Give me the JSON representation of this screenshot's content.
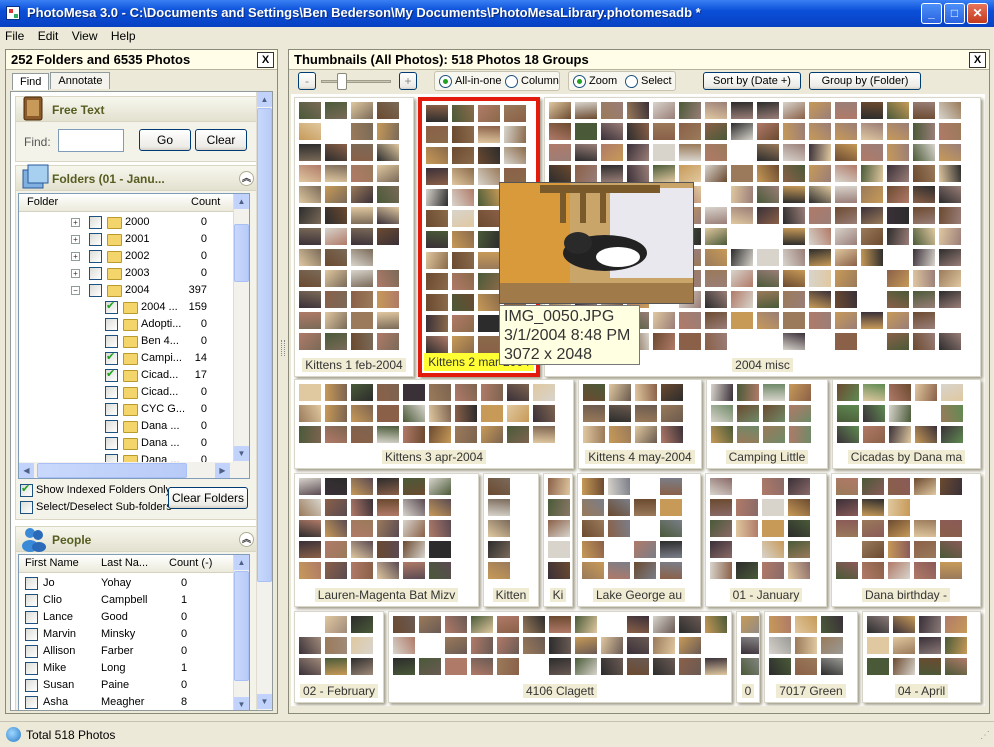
{
  "window": {
    "title": "PhotoMesa 3.0 - C:\\Documents and Settings\\Ben Bederson\\My Documents\\PhotoMesaLibrary.photomesadb *",
    "icons": [
      "app-icon",
      "minimize-icon",
      "maximize-icon",
      "close-icon"
    ]
  },
  "menu": [
    "File",
    "Edit",
    "View",
    "Help"
  ],
  "left_panel": {
    "title": "252 Folders and 6535 Photos",
    "close_label": "X",
    "tabs": [
      "Find",
      "Annotate"
    ],
    "free_text": {
      "title": "Free Text",
      "find_label": "Find:",
      "find_value": "",
      "go_label": "Go",
      "clear_label": "Clear"
    },
    "folders": {
      "title": "Folders (01 - Janu...",
      "col_folder": "Folder",
      "col_count": "Count",
      "rows": [
        {
          "name": "2000",
          "count": "0",
          "checked": false,
          "level": 0,
          "expander": "+"
        },
        {
          "name": "2001",
          "count": "0",
          "checked": false,
          "level": 0,
          "expander": "+"
        },
        {
          "name": "2002",
          "count": "0",
          "checked": false,
          "level": 0,
          "expander": "+"
        },
        {
          "name": "2003",
          "count": "0",
          "checked": false,
          "level": 0,
          "expander": "+"
        },
        {
          "name": "2004",
          "count": "397",
          "checked": false,
          "level": 0,
          "expander": "−"
        },
        {
          "name": "2004 ...",
          "count": "159",
          "checked": true,
          "level": 1,
          "expander": ""
        },
        {
          "name": "Adopti...",
          "count": "0",
          "checked": false,
          "level": 1,
          "expander": ""
        },
        {
          "name": "Ben 4...",
          "count": "0",
          "checked": false,
          "level": 1,
          "expander": ""
        },
        {
          "name": "Campi...",
          "count": "14",
          "checked": true,
          "level": 1,
          "expander": ""
        },
        {
          "name": "Cicad...",
          "count": "17",
          "checked": true,
          "level": 1,
          "expander": ""
        },
        {
          "name": "Cicad...",
          "count": "0",
          "checked": false,
          "level": 1,
          "expander": ""
        },
        {
          "name": "CYC G...",
          "count": "0",
          "checked": false,
          "level": 1,
          "expander": ""
        },
        {
          "name": "Dana ...",
          "count": "0",
          "checked": false,
          "level": 1,
          "expander": ""
        },
        {
          "name": "Dana ...",
          "count": "0",
          "checked": false,
          "level": 1,
          "expander": ""
        },
        {
          "name": "Dana ...",
          "count": "0",
          "checked": false,
          "level": 1,
          "expander": ""
        }
      ],
      "show_indexed_label": "Show Indexed Folders Only",
      "show_indexed_checked": true,
      "select_sub_label": "Select/Deselect Sub-folders",
      "select_sub_checked": false,
      "clear_folders_label": "Clear Folders"
    },
    "people": {
      "title": "People",
      "col_first": "First Name",
      "col_last": "Last Na...",
      "col_count": "Count (-)",
      "rows": [
        {
          "first": "Jo",
          "last": "Yohay",
          "count": "0"
        },
        {
          "first": "Clio",
          "last": "Campbell",
          "count": "1"
        },
        {
          "first": "Lance",
          "last": "Good",
          "count": "0"
        },
        {
          "first": "Marvin",
          "last": "Minsky",
          "count": "0"
        },
        {
          "first": "Allison",
          "last": "Farber",
          "count": "0"
        },
        {
          "first": "Mike",
          "last": "Long",
          "count": "1"
        },
        {
          "first": "Susan",
          "last": "Paine",
          "count": "0"
        },
        {
          "first": "Asha",
          "last": "Meagher",
          "count": "8"
        }
      ]
    }
  },
  "thumb_panel": {
    "title": "Thumbnails (All Photos): 518 Photos 18 Groups",
    "close_label": "X",
    "zoom_minus": "-",
    "zoom_plus": "+",
    "zoom_slider_value": 0.25,
    "layout_options": [
      "All-in-one",
      "Column"
    ],
    "layout_selected": "All-in-one",
    "mode_options": [
      "Zoom",
      "Select"
    ],
    "mode_selected": "Zoom",
    "sort_label": "Sort by (Date +)",
    "group_label": "Group by (Folder)",
    "groups": [
      {
        "label": "Kittens 1 feb-2004",
        "color": "#7a6a58"
      },
      {
        "label": "Kittens 2 mar-2004",
        "color": "#8a6a4a"
      },
      {
        "label": "2004 misc",
        "color": "#9a7e78"
      },
      {
        "label": "Kittens 3 apr-2004",
        "color": "#7d6450"
      },
      {
        "label": "Kittens 4 may-2004",
        "color": "#6a5a4e"
      },
      {
        "label": "Camping Little",
        "color": "#6f8a68"
      },
      {
        "label": "Cicadas by Dana ma",
        "color": "#5f8a52"
      },
      {
        "label": "Lauren-Magenta Bat Mizv",
        "color": "#5a4a52"
      },
      {
        "label": "Kitten",
        "color": "#7a6a5a"
      },
      {
        "label": "Ki",
        "color": "#8a7866"
      },
      {
        "label": "Lake George au",
        "color": "#7a7e88"
      },
      {
        "label": "01 - January",
        "color": "#8a6a68"
      },
      {
        "label": "Dana birthday -",
        "color": "#8a5a58"
      },
      {
        "label": "02 - February",
        "color": "#a08a7a"
      },
      {
        "label": "4106 Clagett",
        "color": "#6a5a54"
      },
      {
        "label": "0",
        "color": "#8a8a8a"
      },
      {
        "label": "7017 Green",
        "color": "#9a9a96"
      },
      {
        "label": "04 - April",
        "color": "#8a7a78"
      }
    ],
    "tooltip": {
      "filename": "IMG_0050.JPG",
      "date": "3/1/2004 8:48 PM",
      "size": "3072 x 2048"
    }
  },
  "status": {
    "text": "Total 518 Photos"
  }
}
